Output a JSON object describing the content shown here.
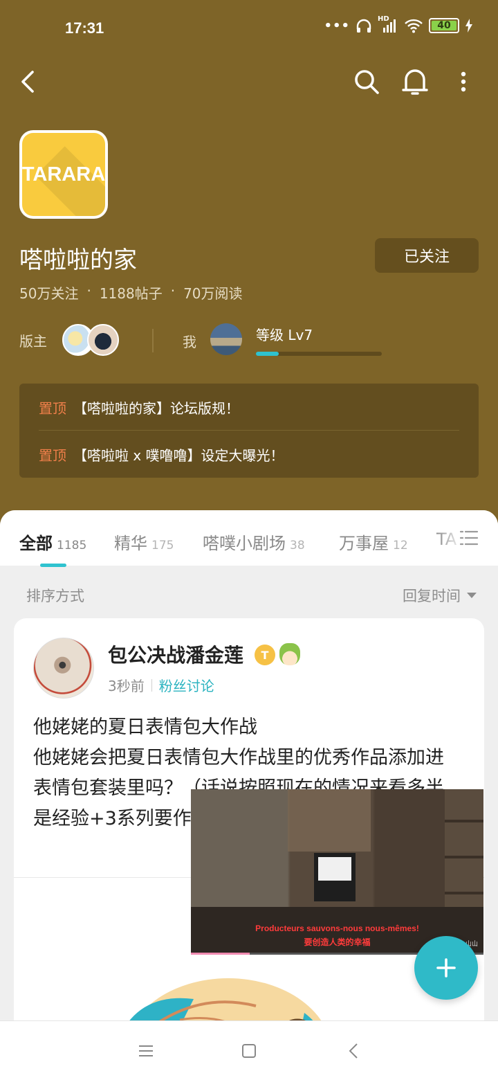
{
  "status_bar": {
    "time": "17:31",
    "dots": "•••",
    "network": "HD",
    "battery": "40"
  },
  "toolbar": {
    "back_icon": "chevron-left-icon",
    "search_icon": "search-icon",
    "notification_icon": "bell-icon",
    "more_icon": "more-vertical-icon"
  },
  "forum": {
    "logo_text": "TARARA",
    "name": "嗒啦啦的家",
    "follow_label": "已关注",
    "stats": [
      "50万关注",
      "·",
      "1188帖子",
      "·",
      "70万阅读"
    ],
    "moderators_label": "版主",
    "me_label": "我",
    "level_label": "等级 Lv7",
    "level_progress": 0.18
  },
  "pinned": [
    {
      "tag": "置顶",
      "text": "【嗒啦啦的家】论坛版规！"
    },
    {
      "tag": "置顶",
      "text": "【嗒啦啦 x 噗噜噜】设定大曝光！"
    }
  ],
  "tabs": [
    {
      "label": "全部",
      "count": "1185",
      "active": true
    },
    {
      "label": "精华",
      "count": "175"
    },
    {
      "label": "嗒噗小剧场",
      "count": "38"
    },
    {
      "label": "万事屋",
      "count": "12"
    },
    {
      "label": "TA",
      "count": ""
    }
  ],
  "sort": {
    "label": "排序方式",
    "value": "回复时间"
  },
  "post": {
    "author": "包公决战潘金莲",
    "badge": "T",
    "time": "3秒前",
    "category": "粉丝讨论",
    "title": "他姥姥的夏日表情包大作战",
    "body": "他姥姥会把夏日表情包大作战里的优秀作品添加进表情包套装里吗？（话说按照现在的情况来看多半是经验+3系列要作为常驻表情包，可"
  },
  "video": {
    "subtitle_fr": "Producteurs sauvons-nous nous-mêmes!",
    "subtitle_zh": "要创造人类的幸福",
    "watermark": "Super18_山山",
    "progress": 0.2
  },
  "colors": {
    "header_bg": "#7e6428",
    "accent": "#2fc2cf",
    "pin_tag": "#f07f4a",
    "logo_bg": "#f9cb3e"
  }
}
